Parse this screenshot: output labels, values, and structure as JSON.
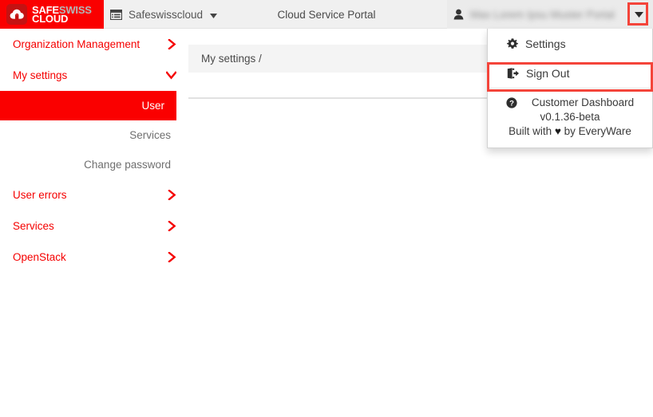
{
  "topbar": {
    "logo": {
      "line1_a": "SAFE",
      "line1_b": "SWISS",
      "line2": "CLOUD",
      "brand_red": "#fa0000",
      "mark_red": "#c41212"
    },
    "org_switcher": {
      "label": "Safeswisscloud",
      "icon": "th-list-icon",
      "caret": "caret-down-icon"
    },
    "portal_title": "Cloud Service Portal",
    "user": {
      "icon": "user-icon",
      "name": "Max Lorem Ipsu Muster Portal",
      "caret": "caret-down-icon"
    }
  },
  "sidebar": {
    "items": [
      {
        "label": "Organization Management",
        "chevron": "chevron-right-icon",
        "type": "group"
      },
      {
        "label": "My settings",
        "chevron": "chevron-down-icon",
        "type": "group"
      },
      {
        "label": "User",
        "type": "sub",
        "active": true
      },
      {
        "label": "Services",
        "type": "sub",
        "active": false
      },
      {
        "label": "Change password",
        "type": "sub",
        "active": false
      },
      {
        "label": "User errors",
        "chevron": "chevron-right-icon",
        "type": "group"
      },
      {
        "label": "Services",
        "chevron": "chevron-right-icon",
        "type": "group"
      },
      {
        "label": "OpenStack",
        "chevron": "chevron-right-icon",
        "type": "group"
      }
    ],
    "active_color": "#fa0000",
    "link_color": "#f50000"
  },
  "main": {
    "breadcrumb": "My settings /"
  },
  "dropdown": {
    "items": [
      {
        "label": "Settings",
        "icon": "gear-icon",
        "highlighted": false
      },
      {
        "label": "Sign Out",
        "icon": "sign-out-icon",
        "highlighted": true
      }
    ],
    "info": {
      "icon": "question-circle-icon",
      "product": "Customer Dashboard",
      "version": "v0.1.36-beta",
      "built_prefix": "Built with",
      "built_heart": "♥",
      "built_suffix": "by EveryWare"
    },
    "highlight_color": "#f4443a"
  }
}
